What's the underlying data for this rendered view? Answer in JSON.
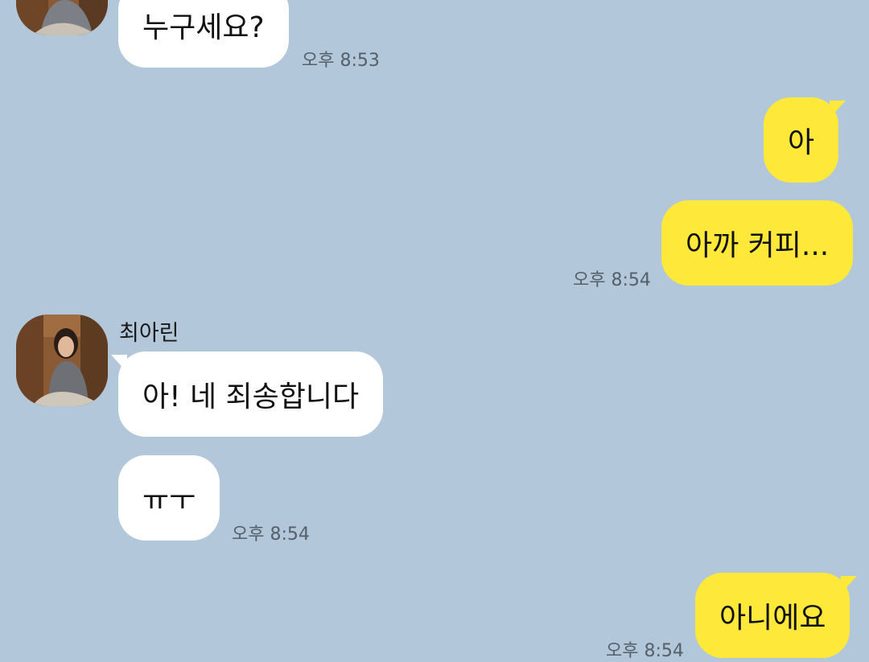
{
  "colors": {
    "background": "#b2c7da",
    "incoming_bubble": "#ffffff",
    "outgoing_bubble": "#fee93a",
    "timestamp": "#545f69"
  },
  "messages": [
    {
      "direction": "incoming",
      "text": "누구세요?",
      "time": "오후 8:53"
    },
    {
      "direction": "outgoing",
      "text": "아",
      "time": ""
    },
    {
      "direction": "outgoing",
      "text": "아까 커피...",
      "time": "오후 8:54"
    },
    {
      "direction": "incoming",
      "sender": "최아린",
      "text": "아! 네 죄송합니다",
      "time": ""
    },
    {
      "direction": "incoming",
      "text": "ㅠㅜ",
      "time": "오후 8:54"
    },
    {
      "direction": "outgoing",
      "text": "아니에요",
      "time": "오후 8:54"
    }
  ],
  "avatar_icon": "profile-photo"
}
